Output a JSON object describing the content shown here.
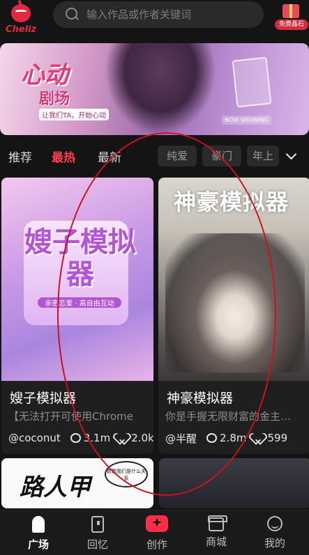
{
  "header": {
    "logo_text": "Cheliz",
    "search_placeholder": "输入作品或作者关键词",
    "gift_label": "免费晶石"
  },
  "banner": {
    "title_line1": "心动",
    "title_line2": "剧场",
    "tagline": "让我们TA，开始心动",
    "badge": "NOW SHOWING"
  },
  "tabs": {
    "items": [
      "推荐",
      "最热",
      "最新"
    ],
    "active": "最热",
    "chips": [
      "纯爱",
      "豪门",
      "年上"
    ]
  },
  "cards": [
    {
      "cover_title": "嫂子模拟器",
      "cover_sub": "亲密恋爱 · 高自由互动",
      "title": "嫂子模拟器",
      "desc": "【无法打开可使用Chrome",
      "author": "@coconut",
      "comments": "3.1m",
      "likes": "2.0k"
    },
    {
      "cover_title": "神豪模拟器",
      "title": "神豪模拟器",
      "desc": "你是手握无限财富的金主…",
      "author": "@半醒",
      "comments": "2.8m",
      "likes": "599"
    }
  ],
  "peek_cards": [
    {
      "cover_title": "路人甲",
      "bubble": "数数我们是什么关系"
    },
    {}
  ],
  "nav": {
    "items": [
      "广场",
      "回忆",
      "创作",
      "商城",
      "我的"
    ],
    "active": "广场"
  },
  "colors": {
    "accent": "#ff3d4c",
    "background": "#141414",
    "annotation": "#c8141e"
  },
  "icons": [
    "search-icon",
    "gift-icon",
    "comment-icon",
    "heart-icon",
    "chevron-down-icon",
    "home-icon",
    "book-icon",
    "sparkle-icon",
    "shop-icon",
    "smile-icon"
  ]
}
